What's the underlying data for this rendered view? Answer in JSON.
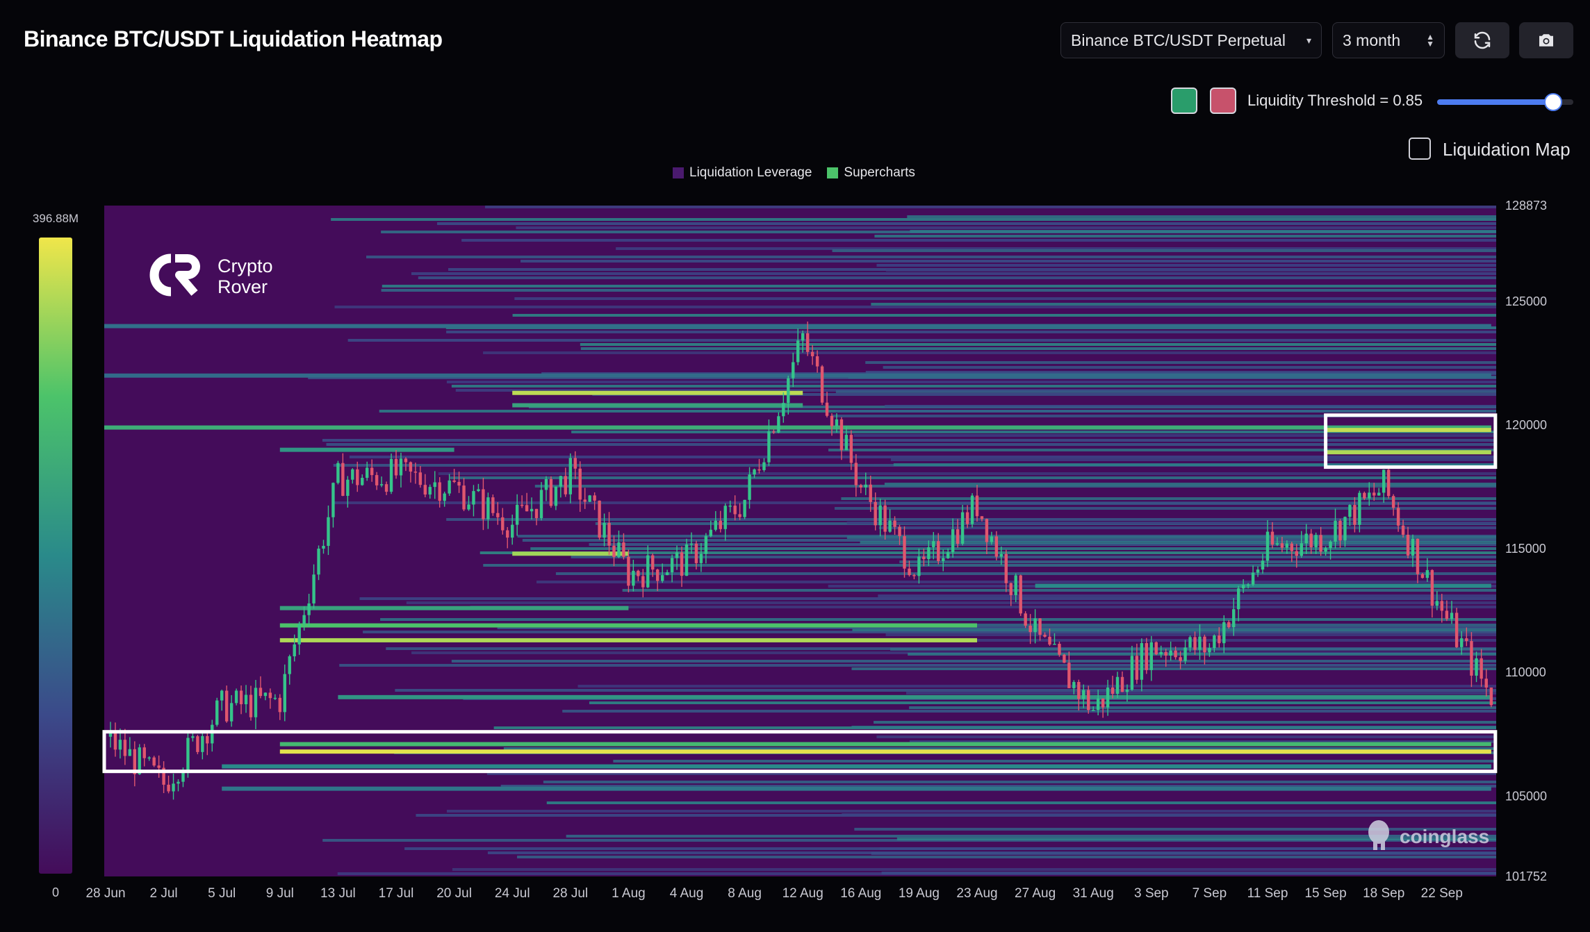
{
  "header": {
    "title": "Binance BTC/USDT Liquidation Heatmap",
    "pair_select": "Binance BTC/USDT Perpetual",
    "range_select": "3 month",
    "refresh_icon": "refresh-icon",
    "camera_icon": "camera-icon"
  },
  "controls": {
    "swatch_colors": [
      "#2a9d6b",
      "#c7526b"
    ],
    "threshold_label": "Liquidity Threshold = 0.85",
    "threshold_value": 0.85,
    "liquidation_map_label": "Liquidation Map",
    "liquidation_map_checked": false
  },
  "legend": {
    "items": [
      {
        "label": "Liquidation Leverage",
        "color": "#4a1a6e"
      },
      {
        "label": "Supercharts",
        "color": "#4cc36a"
      }
    ]
  },
  "colorbar": {
    "max_label": "396.88M",
    "min_label": "0"
  },
  "watermarks": {
    "brand_line1": "Crypto",
    "brand_line2": "Rover",
    "provider": "coinglass"
  },
  "colors": {
    "bg": "#050509",
    "heat_low": "#440c5a",
    "heat_high": "#f0e64a",
    "candle_up": "#35c48a",
    "candle_down": "#e0566e",
    "highlight_box": "#ffffff"
  },
  "chart_data": {
    "type": "heatmap",
    "x_ticks": [
      "28 Jun",
      "2 Jul",
      "5 Jul",
      "9 Jul",
      "13 Jul",
      "17 Jul",
      "20 Jul",
      "24 Jul",
      "28 Jul",
      "1 Aug",
      "4 Aug",
      "8 Aug",
      "12 Aug",
      "16 Aug",
      "19 Aug",
      "23 Aug",
      "27 Aug",
      "31 Aug",
      "3 Sep",
      "7 Sep",
      "11 Sep",
      "15 Sep",
      "18 Sep",
      "22 Sep"
    ],
    "y_ticks": [
      128873,
      125000,
      120000,
      115000,
      110000,
      105000,
      101752
    ],
    "ylim": [
      101752,
      128873
    ],
    "price_path": [
      {
        "x": "28 Jun",
        "y": 107400
      },
      {
        "x": "2 Jul",
        "y": 105500
      },
      {
        "x": "5 Jul",
        "y": 108600
      },
      {
        "x": "9 Jul",
        "y": 108900
      },
      {
        "x": "13 Jul",
        "y": 117800
      },
      {
        "x": "17 Jul",
        "y": 118000
      },
      {
        "x": "20 Jul",
        "y": 117500
      },
      {
        "x": "24 Jul",
        "y": 116000
      },
      {
        "x": "28 Jul",
        "y": 118000
      },
      {
        "x": "1 Aug",
        "y": 114000
      },
      {
        "x": "4 Aug",
        "y": 114500
      },
      {
        "x": "8 Aug",
        "y": 117000
      },
      {
        "x": "12 Aug",
        "y": 123500
      },
      {
        "x": "16 Aug",
        "y": 117500
      },
      {
        "x": "19 Aug",
        "y": 114000
      },
      {
        "x": "23 Aug",
        "y": 116800
      },
      {
        "x": "27 Aug",
        "y": 111500
      },
      {
        "x": "31 Aug",
        "y": 108500
      },
      {
        "x": "3 Sep",
        "y": 111000
      },
      {
        "x": "7 Sep",
        "y": 111000
      },
      {
        "x": "11 Sep",
        "y": 115000
      },
      {
        "x": "15 Sep",
        "y": 115500
      },
      {
        "x": "18 Sep",
        "y": 117500
      },
      {
        "x": "22 Sep",
        "y": 112500
      },
      {
        "x": "25 Sep",
        "y": 109000
      }
    ],
    "liquidity_bands": [
      {
        "from": "9 Jul",
        "to": "25 Sep",
        "y": 106800,
        "intensity": 0.98
      },
      {
        "from": "9 Jul",
        "to": "25 Sep",
        "y": 107100,
        "intensity": 0.7
      },
      {
        "from": "9 Jul",
        "to": "23 Aug",
        "y": 111300,
        "intensity": 0.9
      },
      {
        "from": "9 Jul",
        "to": "23 Aug",
        "y": 111900,
        "intensity": 0.75
      },
      {
        "from": "9 Jul",
        "to": "1 Aug",
        "y": 112600,
        "intensity": 0.6
      },
      {
        "from": "24 Jul",
        "to": "12 Aug",
        "y": 121300,
        "intensity": 0.92
      },
      {
        "from": "24 Jul",
        "to": "12 Aug",
        "y": 120800,
        "intensity": 0.6
      },
      {
        "from": "24 Jul",
        "to": "1 Aug",
        "y": 114800,
        "intensity": 0.88
      },
      {
        "from": "13 Aug",
        "to": "25 Sep",
        "y": 119900,
        "intensity": 0.65
      },
      {
        "from": "15 Sep",
        "to": "25 Sep",
        "y": 119800,
        "intensity": 0.93
      },
      {
        "from": "15 Sep",
        "to": "25 Sep",
        "y": 118900,
        "intensity": 0.9
      },
      {
        "from": "9 Jul",
        "to": "20 Jul",
        "y": 119000,
        "intensity": 0.55
      },
      {
        "from": "13 Jul",
        "to": "25 Sep",
        "y": 109000,
        "intensity": 0.55
      },
      {
        "from": "5 Jul",
        "to": "25 Sep",
        "y": 106200,
        "intensity": 0.5
      },
      {
        "from": "5 Jul",
        "to": "25 Sep",
        "y": 105300,
        "intensity": 0.42
      },
      {
        "from": "13 Aug",
        "to": "25 Sep",
        "y": 124000,
        "intensity": 0.4
      },
      {
        "from": "13 Aug",
        "to": "25 Sep",
        "y": 122000,
        "intensity": 0.38
      },
      {
        "from": "27 Aug",
        "to": "25 Sep",
        "y": 113500,
        "intensity": 0.5
      }
    ],
    "highlights": [
      {
        "from": "15 Sep",
        "to": "25 Sep",
        "y_low": 118300,
        "y_high": 120400
      },
      {
        "from": "28 Aug",
        "to": "25 Sep",
        "y_low": 106000,
        "y_high": 107600
      }
    ],
    "xlabel": "",
    "ylabel": "",
    "legend_position": "top-center"
  }
}
